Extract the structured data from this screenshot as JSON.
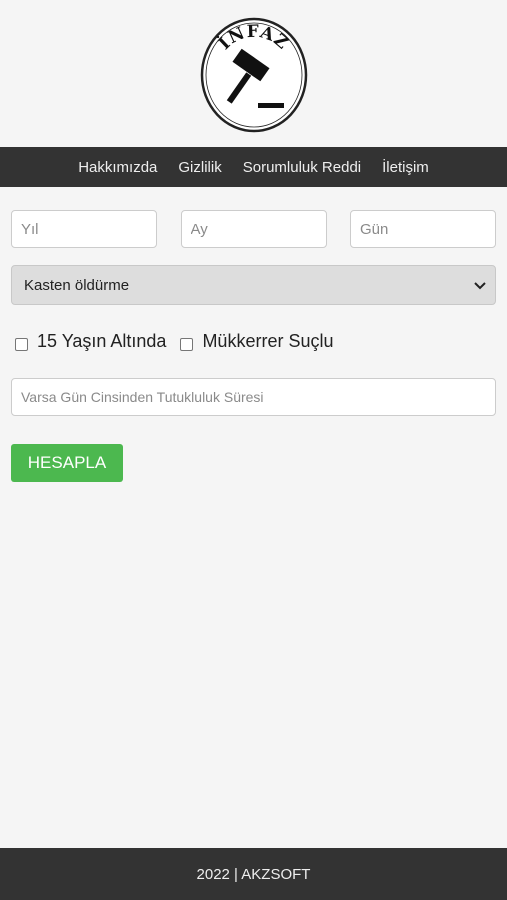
{
  "logo": {
    "text": "İNFAZ",
    "icon": "gavel-icon"
  },
  "nav": {
    "items": [
      "Hakkımızda",
      "Gizlilik",
      "Sorumluluk Reddi",
      "İletişim"
    ]
  },
  "form": {
    "year_placeholder": "Yıl",
    "month_placeholder": "Ay",
    "day_placeholder": "Gün",
    "crime_selected": "Kasten öldürme",
    "under15_label": "15 Yaşın Altında",
    "repeat_offender_label": "Mükkerrer Suçlu",
    "detention_placeholder": "Varsa Gün Cinsinden Tutukluluk Süresi",
    "calculate_label": "HESAPLA"
  },
  "footer": {
    "text": "2022 | AKZSOFT"
  },
  "colors": {
    "nav_bg": "#333333",
    "button_bg": "#4cb84f",
    "page_bg": "#f5f5f5"
  }
}
